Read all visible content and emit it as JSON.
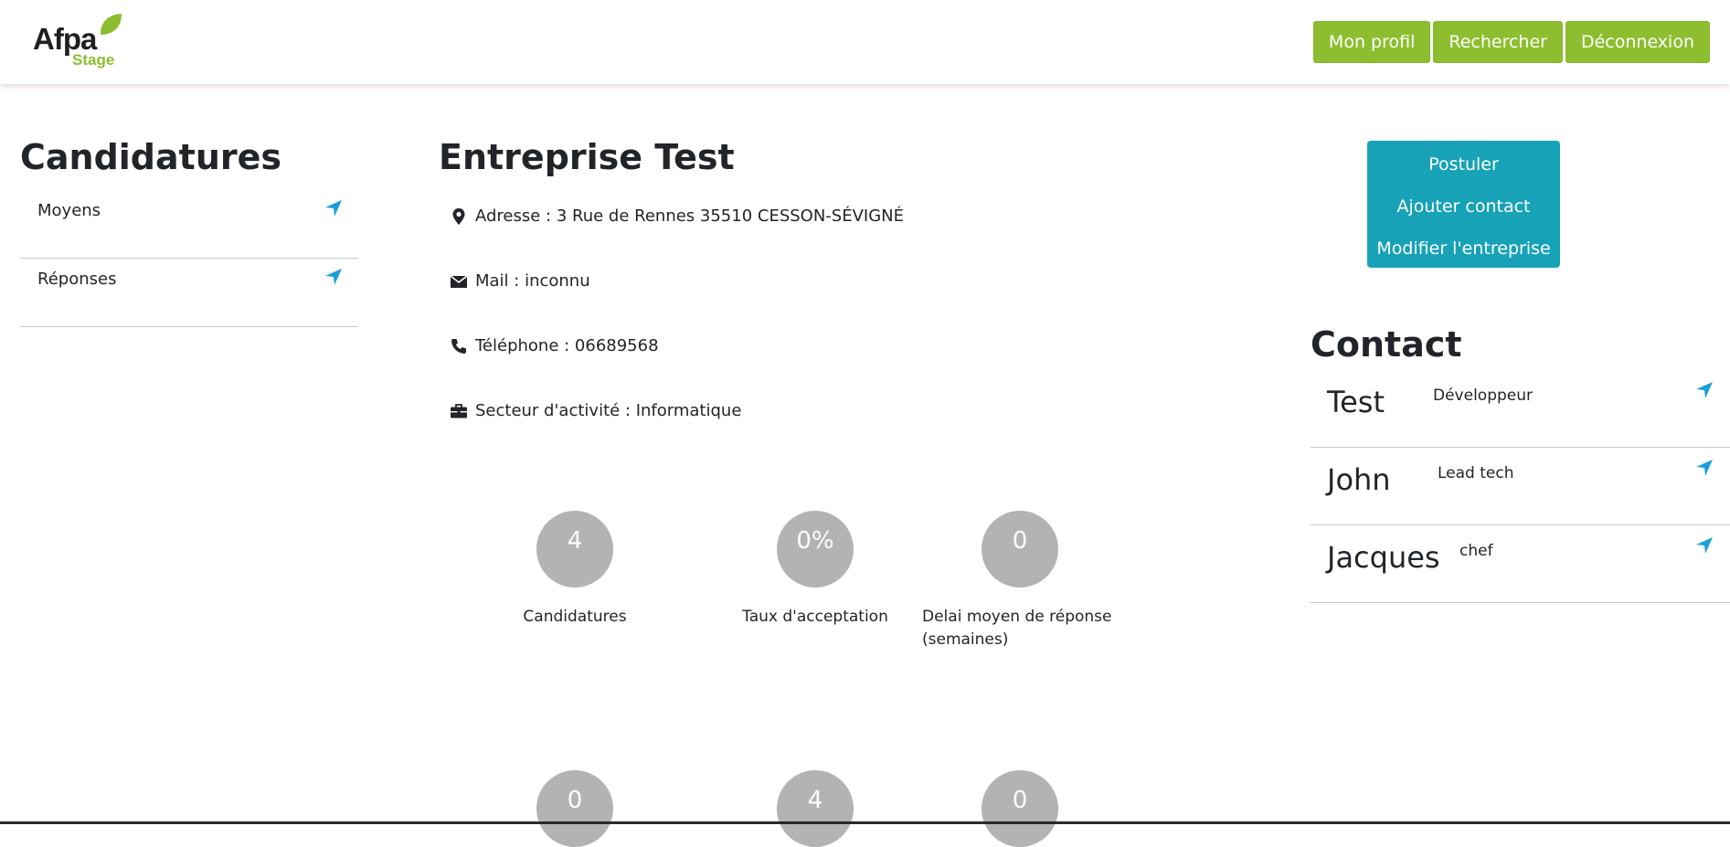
{
  "header": {
    "logo_main": "Afpa",
    "logo_sub": "Stage",
    "nav": [
      {
        "label": "Mon profil"
      },
      {
        "label": "Rechercher"
      },
      {
        "label": "Déconnexion"
      }
    ]
  },
  "sidebar": {
    "title": "Candidatures",
    "items": [
      {
        "label": "Moyens"
      },
      {
        "label": "Réponses"
      }
    ]
  },
  "company": {
    "name": "Entreprise Test",
    "address": "Adresse : 3 Rue de Rennes 35510 CESSON-SÉVIGNÉ",
    "mail": "Mail : inconnu",
    "phone": "Téléphone : 06689568",
    "sector": "Secteur d'activité : Informatique"
  },
  "stats": [
    {
      "value": "4",
      "label": "Candidatures"
    },
    {
      "value": "0%",
      "label": "Taux d'acceptation"
    },
    {
      "value": "0",
      "label": "Delai moyen de réponse (semaines)"
    },
    {
      "value": "0",
      "label": ""
    },
    {
      "value": "4",
      "label": ""
    },
    {
      "value": "0",
      "label": ""
    }
  ],
  "actions": [
    {
      "label": "Postuler"
    },
    {
      "label": "Ajouter contact"
    },
    {
      "label": "Modifier l'entreprise"
    }
  ],
  "contacts": {
    "title": "Contact",
    "items": [
      {
        "name": "Test",
        "role": "Développeur"
      },
      {
        "name": "John",
        "role": "Lead tech"
      },
      {
        "name": "Jacques",
        "role": "chef"
      }
    ]
  },
  "colors": {
    "brand_green": "#8dbe2f",
    "action_teal": "#17a2b8",
    "arrow_blue": "#1a9fd8",
    "stat_grey": "#b3b3b3"
  },
  "icons": {
    "logo": "leaf-icon",
    "link_arrow": "location-arrow-icon",
    "address": "map-marker-icon",
    "mail": "envelope-icon",
    "phone": "phone-icon",
    "sector": "briefcase-icon"
  }
}
